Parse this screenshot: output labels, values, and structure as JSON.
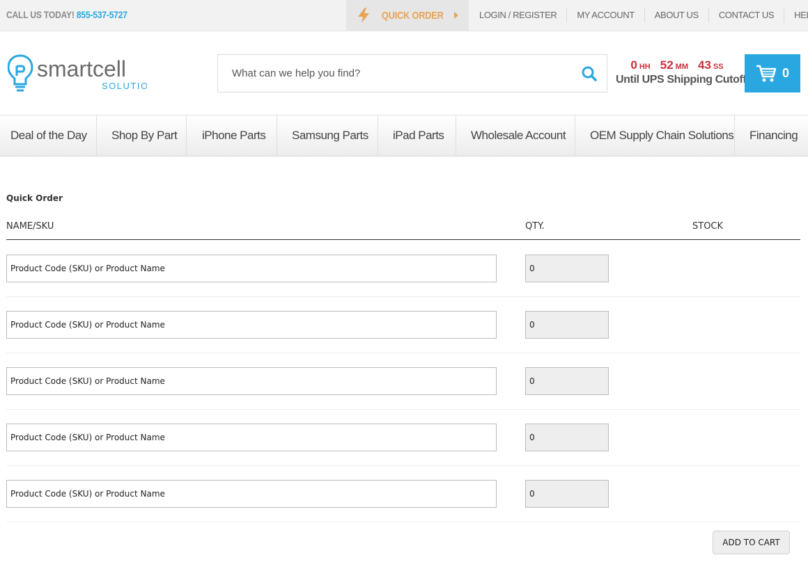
{
  "topbar": {
    "call_label": "CALL US TODAY!",
    "phone": "855-537-5727",
    "quick_order": "QUICK ORDER",
    "links": [
      "LOGIN / REGISTER",
      "MY ACCOUNT",
      "ABOUT US",
      "CONTACT US",
      "HELP/FAQ"
    ]
  },
  "logo": {
    "name": "smartcell",
    "tagline": "SOLUTIONS"
  },
  "search": {
    "placeholder": "What can we help you find?"
  },
  "countdown": {
    "hours": "0",
    "hours_unit": "HH",
    "minutes": "52",
    "minutes_unit": "MM",
    "seconds": "43",
    "seconds_unit": "SS",
    "label": "Until UPS Shipping Cutoff"
  },
  "cart": {
    "count": "0"
  },
  "nav": [
    "Deal of the Day",
    "Shop By Part",
    "iPhone Parts",
    "Samsung Parts",
    "iPad Parts",
    "Wholesale Account",
    "OEM Supply Chain Solutions",
    "Financing"
  ],
  "quick_order": {
    "title": "Quick Order",
    "headers": {
      "name": "NAME/SKU",
      "qty": "QTY.",
      "stock": "STOCK"
    },
    "rows": [
      {
        "name_placeholder": "Product Code (SKU) or Product Name",
        "qty": "0"
      },
      {
        "name_placeholder": "Product Code (SKU) or Product Name",
        "qty": "0"
      },
      {
        "name_placeholder": "Product Code (SKU) or Product Name",
        "qty": "0"
      },
      {
        "name_placeholder": "Product Code (SKU) or Product Name",
        "qty": "0"
      },
      {
        "name_placeholder": "Product Code (SKU) or Product Name",
        "qty": "0"
      }
    ],
    "add_to_cart": "ADD TO CART"
  },
  "colors": {
    "brand_blue": "#29a7e1",
    "quick_order_orange": "#e8a355",
    "countdown_red": "#c9303c"
  }
}
